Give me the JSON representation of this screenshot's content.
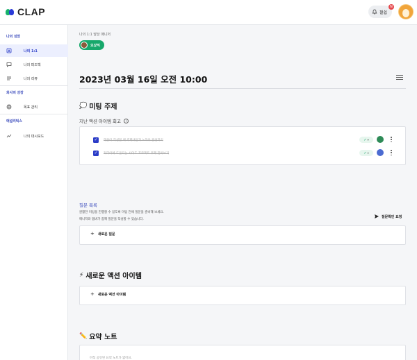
{
  "app": {
    "logo_text": "CLAP",
    "brand_colors": [
      "#17b26a",
      "#2a3bd8"
    ]
  },
  "header": {
    "notification_label": "펄쉽",
    "notification_badge": "N",
    "notification_icon": "bell-icon",
    "avatar_icon": "user-avatar"
  },
  "sidebar": {
    "section_growth": "나의 성장",
    "item_one_on_one": "나의 1:1",
    "item_feedback": "나의 피드백",
    "item_review": "나의 리뷰",
    "section_company": "회사의 성장",
    "item_goals": "목표 관리",
    "section_analytics": "애널리틱스",
    "item_dashboard": "나의 대시보드"
  },
  "meeting": {
    "manager_label": "나의 1:1 담당 매니저",
    "manager_name": "오상익",
    "date_title": "2023년 03월 16일 오전 10:00"
  },
  "topic": {
    "emoji": "💭",
    "title": "미팅 주제",
    "review_label": "지난 액션 아이템 회고",
    "action_items": [
      {
        "text": "레온아 작성할 때 주제내용과 노하우 완성하기",
        "checked": true,
        "status": "✓"
      },
      {
        "text": "커리어에 도움되는 사이드 프로젝트 주제 찾아보기",
        "checked": true,
        "status": "✓"
      }
    ]
  },
  "questions": {
    "title": "질문 목록",
    "desc_line1": "원활한 미팅을 진행할 수 있도록 미팅 전에 질문을 준비해 보세요.",
    "desc_line2": "매니저와 멤버가 함께 질문을 작성할 수 있습니다.",
    "request_label": "질문확인 요청",
    "add_label": "새로운 질문"
  },
  "new_actions": {
    "emoji": "⚡",
    "title": "새로운 액션 아이템",
    "add_label": "새로운 액션 아이템"
  },
  "summary": {
    "emoji": "✏️",
    "title": "요약 노트",
    "placeholder": "아직 공유된 요약 노트가 없어요."
  }
}
